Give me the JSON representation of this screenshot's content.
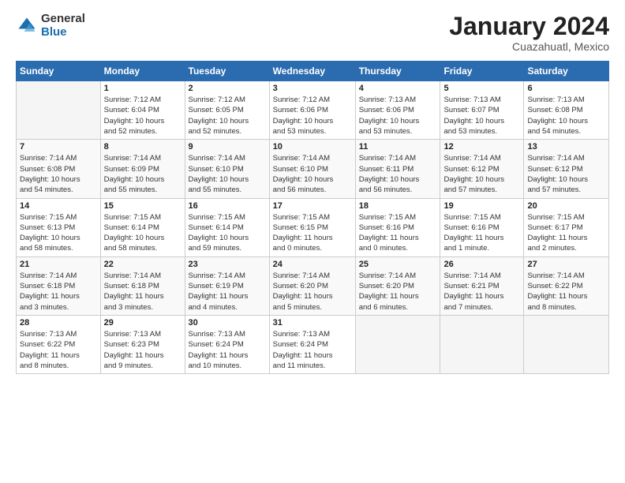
{
  "logo": {
    "general": "General",
    "blue": "Blue"
  },
  "title": "January 2024",
  "location": "Cuazahuatl, Mexico",
  "weekdays": [
    "Sunday",
    "Monday",
    "Tuesday",
    "Wednesday",
    "Thursday",
    "Friday",
    "Saturday"
  ],
  "weeks": [
    [
      {
        "day": "",
        "info": ""
      },
      {
        "day": "1",
        "info": "Sunrise: 7:12 AM\nSunset: 6:04 PM\nDaylight: 10 hours\nand 52 minutes."
      },
      {
        "day": "2",
        "info": "Sunrise: 7:12 AM\nSunset: 6:05 PM\nDaylight: 10 hours\nand 52 minutes."
      },
      {
        "day": "3",
        "info": "Sunrise: 7:12 AM\nSunset: 6:06 PM\nDaylight: 10 hours\nand 53 minutes."
      },
      {
        "day": "4",
        "info": "Sunrise: 7:13 AM\nSunset: 6:06 PM\nDaylight: 10 hours\nand 53 minutes."
      },
      {
        "day": "5",
        "info": "Sunrise: 7:13 AM\nSunset: 6:07 PM\nDaylight: 10 hours\nand 53 minutes."
      },
      {
        "day": "6",
        "info": "Sunrise: 7:13 AM\nSunset: 6:08 PM\nDaylight: 10 hours\nand 54 minutes."
      }
    ],
    [
      {
        "day": "7",
        "info": "Sunrise: 7:14 AM\nSunset: 6:08 PM\nDaylight: 10 hours\nand 54 minutes."
      },
      {
        "day": "8",
        "info": "Sunrise: 7:14 AM\nSunset: 6:09 PM\nDaylight: 10 hours\nand 55 minutes."
      },
      {
        "day": "9",
        "info": "Sunrise: 7:14 AM\nSunset: 6:10 PM\nDaylight: 10 hours\nand 55 minutes."
      },
      {
        "day": "10",
        "info": "Sunrise: 7:14 AM\nSunset: 6:10 PM\nDaylight: 10 hours\nand 56 minutes."
      },
      {
        "day": "11",
        "info": "Sunrise: 7:14 AM\nSunset: 6:11 PM\nDaylight: 10 hours\nand 56 minutes."
      },
      {
        "day": "12",
        "info": "Sunrise: 7:14 AM\nSunset: 6:12 PM\nDaylight: 10 hours\nand 57 minutes."
      },
      {
        "day": "13",
        "info": "Sunrise: 7:14 AM\nSunset: 6:12 PM\nDaylight: 10 hours\nand 57 minutes."
      }
    ],
    [
      {
        "day": "14",
        "info": "Sunrise: 7:15 AM\nSunset: 6:13 PM\nDaylight: 10 hours\nand 58 minutes."
      },
      {
        "day": "15",
        "info": "Sunrise: 7:15 AM\nSunset: 6:14 PM\nDaylight: 10 hours\nand 58 minutes."
      },
      {
        "day": "16",
        "info": "Sunrise: 7:15 AM\nSunset: 6:14 PM\nDaylight: 10 hours\nand 59 minutes."
      },
      {
        "day": "17",
        "info": "Sunrise: 7:15 AM\nSunset: 6:15 PM\nDaylight: 11 hours\nand 0 minutes."
      },
      {
        "day": "18",
        "info": "Sunrise: 7:15 AM\nSunset: 6:16 PM\nDaylight: 11 hours\nand 0 minutes."
      },
      {
        "day": "19",
        "info": "Sunrise: 7:15 AM\nSunset: 6:16 PM\nDaylight: 11 hours\nand 1 minute."
      },
      {
        "day": "20",
        "info": "Sunrise: 7:15 AM\nSunset: 6:17 PM\nDaylight: 11 hours\nand 2 minutes."
      }
    ],
    [
      {
        "day": "21",
        "info": "Sunrise: 7:14 AM\nSunset: 6:18 PM\nDaylight: 11 hours\nand 3 minutes."
      },
      {
        "day": "22",
        "info": "Sunrise: 7:14 AM\nSunset: 6:18 PM\nDaylight: 11 hours\nand 3 minutes."
      },
      {
        "day": "23",
        "info": "Sunrise: 7:14 AM\nSunset: 6:19 PM\nDaylight: 11 hours\nand 4 minutes."
      },
      {
        "day": "24",
        "info": "Sunrise: 7:14 AM\nSunset: 6:20 PM\nDaylight: 11 hours\nand 5 minutes."
      },
      {
        "day": "25",
        "info": "Sunrise: 7:14 AM\nSunset: 6:20 PM\nDaylight: 11 hours\nand 6 minutes."
      },
      {
        "day": "26",
        "info": "Sunrise: 7:14 AM\nSunset: 6:21 PM\nDaylight: 11 hours\nand 7 minutes."
      },
      {
        "day": "27",
        "info": "Sunrise: 7:14 AM\nSunset: 6:22 PM\nDaylight: 11 hours\nand 8 minutes."
      }
    ],
    [
      {
        "day": "28",
        "info": "Sunrise: 7:13 AM\nSunset: 6:22 PM\nDaylight: 11 hours\nand 8 minutes."
      },
      {
        "day": "29",
        "info": "Sunrise: 7:13 AM\nSunset: 6:23 PM\nDaylight: 11 hours\nand 9 minutes."
      },
      {
        "day": "30",
        "info": "Sunrise: 7:13 AM\nSunset: 6:24 PM\nDaylight: 11 hours\nand 10 minutes."
      },
      {
        "day": "31",
        "info": "Sunrise: 7:13 AM\nSunset: 6:24 PM\nDaylight: 11 hours\nand 11 minutes."
      },
      {
        "day": "",
        "info": ""
      },
      {
        "day": "",
        "info": ""
      },
      {
        "day": "",
        "info": ""
      }
    ]
  ]
}
